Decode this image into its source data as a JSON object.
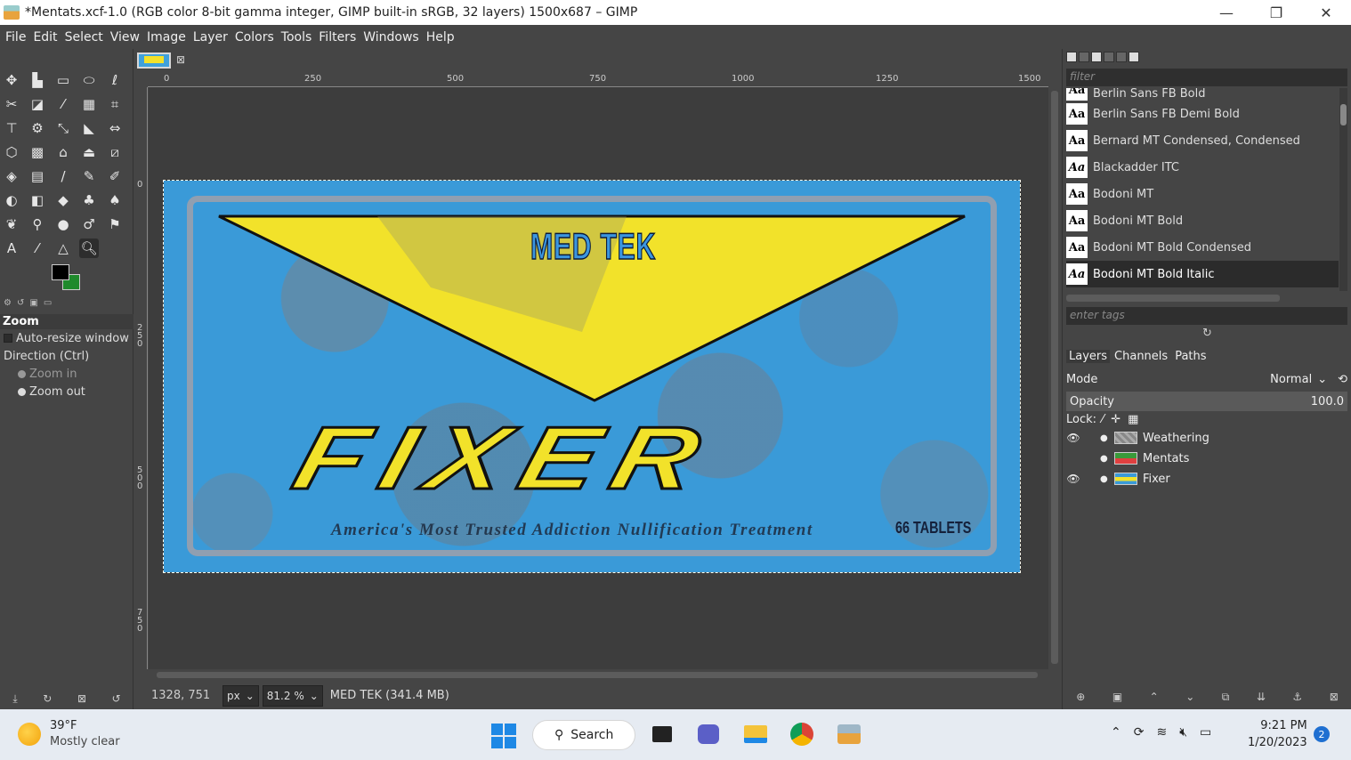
{
  "window": {
    "title": "*Mentats.xcf-1.0 (RGB color 8-bit gamma integer, GIMP built-in sRGB, 32 layers) 1500x687 – GIMP",
    "minimize": "—",
    "maximize": "❐",
    "close": "✕"
  },
  "menu": [
    "File",
    "Edit",
    "Select",
    "View",
    "Image",
    "Layer",
    "Colors",
    "Tools",
    "Filters",
    "Windows",
    "Help"
  ],
  "tool_options": {
    "title": "Zoom",
    "auto_resize": "Auto-resize window",
    "direction": "Direction  (Ctrl)",
    "zoom_in": "Zoom in",
    "zoom_out": "Zoom out"
  },
  "ruler": {
    "top": [
      "0",
      "250",
      "500",
      "750",
      "1000",
      "1250",
      "1500"
    ],
    "left": [
      "0",
      "2\n5\n0",
      "5\n0\n0",
      "7\n5\n0"
    ]
  },
  "artwork": {
    "brand": "MED TEK",
    "product": "FIXER",
    "tagline": "America's Most Trusted Addiction Nullification Treatment",
    "count": "66 TABLETS",
    "colors": {
      "background": "#3a9ad8",
      "banner": "#f2e22a"
    }
  },
  "status": {
    "coords": "1328, 751",
    "unit": "px",
    "zoom": "81.2 %",
    "message": "MED TEK (341.4 MB)"
  },
  "fonts": {
    "filter_placeholder": "filter",
    "tags_placeholder": "enter tags",
    "items": [
      "Berlin Sans FB Bold",
      "Berlin Sans FB Demi Bold",
      "Bernard MT Condensed, Condensed",
      "Blackadder ITC",
      "Bodoni MT",
      "Bodoni MT Bold",
      "Bodoni MT Bold Condensed",
      "Bodoni MT Bold Italic"
    ],
    "selected_index": 7
  },
  "layers_panel": {
    "tabs": [
      "Layers",
      "Channels",
      "Paths"
    ],
    "mode_label": "Mode",
    "mode_value": "Normal",
    "opacity_label": "Opacity",
    "opacity_value": "100.0",
    "lock_label": "Lock:",
    "layers": [
      {
        "name": "Weathering",
        "visible": true
      },
      {
        "name": "Mentats",
        "visible": false
      },
      {
        "name": "Fixer",
        "visible": true
      }
    ]
  },
  "taskbar": {
    "weather_temp": "39°F",
    "weather_desc": "Mostly clear",
    "search": "Search",
    "time": "9:21 PM",
    "date": "1/20/2023",
    "notifications": "2"
  }
}
